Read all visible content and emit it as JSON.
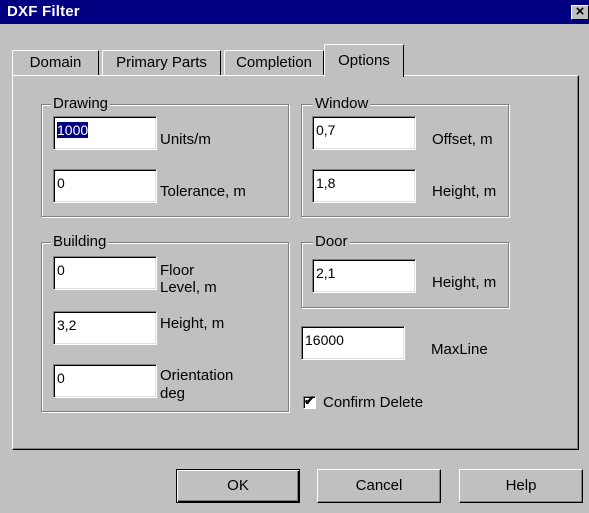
{
  "window": {
    "title": "DXF Filter",
    "close_label": "×"
  },
  "tabs": [
    "Domain",
    "Primary Parts",
    "Completion",
    "Options"
  ],
  "active_tab": "Options",
  "drawing": {
    "legend": "Drawing",
    "units_value": "1000",
    "units_label": "Units/m",
    "tolerance_value": "0",
    "tolerance_label": "Tolerance, m"
  },
  "window_group": {
    "legend": "Window",
    "offset_value": "0,7",
    "offset_label": "Offset, m",
    "height_value": "1,8",
    "height_label": "Height, m"
  },
  "building": {
    "legend": "Building",
    "floor_value": "0",
    "floor_label_1": "Floor",
    "floor_label_2": "Level, m",
    "height_value": "3,2",
    "height_label": "Height, m",
    "orientation_value": "0",
    "orientation_label_1": "Orientation",
    "orientation_label_2": "deg"
  },
  "door": {
    "legend": "Door",
    "height_value": "2,1",
    "height_label": "Height, m"
  },
  "maxline": {
    "value": "16000",
    "label": "MaxLine"
  },
  "confirm_delete": {
    "label": "Confirm Delete",
    "checked": true,
    "mark": "✔"
  },
  "buttons": {
    "ok": "OK",
    "cancel": "Cancel",
    "help": "Help"
  }
}
